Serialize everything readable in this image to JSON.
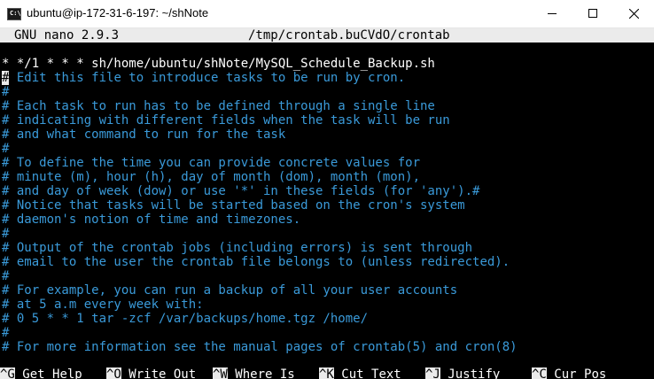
{
  "window": {
    "title": "ubuntu@ip-172-31-6-197: ~/shNote",
    "icon": "terminal-icon"
  },
  "nano": {
    "version": "GNU nano 2.9.3",
    "file": "/tmp/crontab.buCVdO/crontab"
  },
  "content": {
    "line0": "* */1 * * * sh/home/ubuntu/shNote/MySQL_Schedule_Backup.sh",
    "line1_cursor": "#",
    "line1_rest": " Edit this file to introduce tasks to be run by cron.",
    "lines": [
      "#",
      "# Each task to run has to be defined through a single line",
      "# indicating with different fields when the task will be run",
      "# and what command to run for the task",
      "#",
      "# To define the time you can provide concrete values for",
      "# minute (m), hour (h), day of month (dom), month (mon),",
      "# and day of week (dow) or use '*' in these fields (for 'any').#",
      "# Notice that tasks will be started based on the cron's system",
      "# daemon's notion of time and timezones.",
      "#",
      "# Output of the crontab jobs (including errors) is sent through",
      "# email to the user the crontab file belongs to (unless redirected).",
      "#",
      "# For example, you can run a backup of all your user accounts",
      "# at 5 a.m every week with:",
      "# 0 5 * * 1 tar -zcf /var/backups/home.tgz /home/",
      "#",
      "# For more information see the manual pages of crontab(5) and cron(8)"
    ]
  },
  "shortcuts": [
    {
      "key": "^G",
      "label": "Get Help"
    },
    {
      "key": "^O",
      "label": "Write Out"
    },
    {
      "key": "^W",
      "label": "Where Is"
    },
    {
      "key": "^K",
      "label": "Cut Text"
    },
    {
      "key": "^J",
      "label": "Justify"
    },
    {
      "key": "^C",
      "label": "Cur Pos"
    }
  ],
  "colors": {
    "comment": "#3a9ad9",
    "bar": "#ebebeb",
    "background": "#000000"
  }
}
